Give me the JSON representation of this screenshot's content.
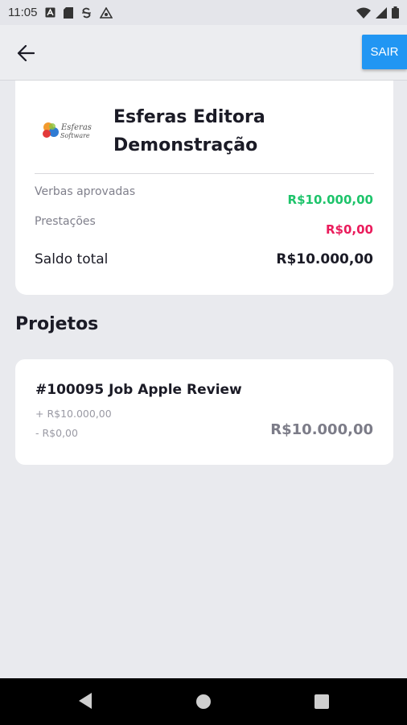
{
  "status_bar": {
    "time": "11:05",
    "icons_left": [
      "font-a-icon",
      "sd-card-icon",
      "sync-s-icon",
      "vpn-triangle-icon"
    ],
    "icons_right": [
      "wifi-icon",
      "signal-icon",
      "battery-icon"
    ]
  },
  "app_bar": {
    "back_icon": "arrow-left-icon",
    "logout_label": "SAIR",
    "logout_color": "#2196f3"
  },
  "company": {
    "logo_text_line1": "Esferas",
    "logo_text_line2": "Software",
    "name_line1": "Esferas Editora",
    "name_line2": "Demonstração",
    "approved_label": "Verbas aprovadas",
    "approved_value": "R$10.000,00",
    "approved_color": "#1ec46b",
    "expenses_label": "Prestações",
    "expenses_value": "R$0,00",
    "expenses_color": "#ea1c5c",
    "balance_label": "Saldo total",
    "balance_value": "R$10.000,00"
  },
  "projects": {
    "section_title": "Projetos",
    "items": [
      {
        "title": "#100095 Job Apple Review",
        "income": "+ R$10.000,00",
        "expense": "- R$0,00",
        "total": "R$10.000,00"
      }
    ]
  },
  "nav_bar": {
    "buttons": [
      "back-triangle-icon",
      "home-circle-icon",
      "recents-square-icon"
    ]
  }
}
